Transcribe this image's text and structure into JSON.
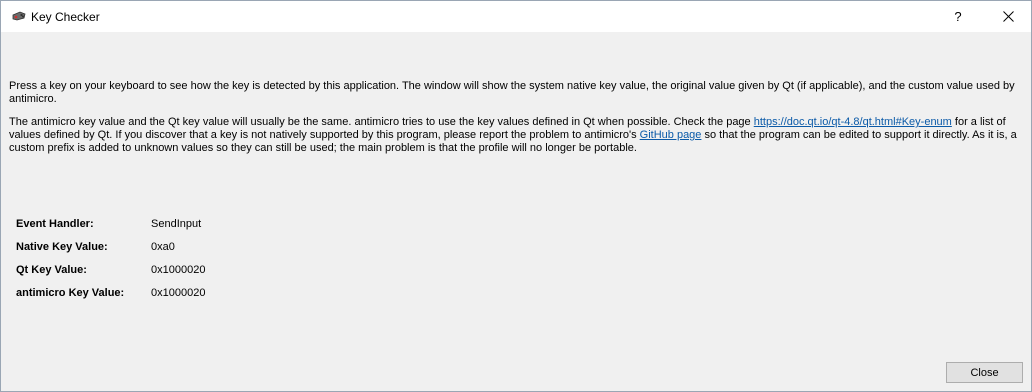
{
  "window": {
    "title": "Key Checker",
    "help_label": "?",
    "app_icon": "gamepad-icon",
    "close_icon": "close-icon"
  },
  "description": {
    "p1": "Press a key on your keyboard to see how the key is detected by this application. The window will show the system native key value, the original value given by Qt (if applicable), and the custom value used by antimicro.",
    "p2_part1": "The antimicro key value and the Qt key value will usually be the same. antimicro tries to use the key values defined in Qt when possible. Check the page ",
    "p2_link1": "https://doc.qt.io/qt-4.8/qt.html#Key-enum",
    "p2_part2": " for a list of values defined by Qt. If you discover that a key is not natively supported by this program, please report the problem to antimicro's ",
    "p2_link2": "GitHub page",
    "p2_part3": " so that the program can be edited to support it directly. As it is, a custom prefix is added to unknown values so they can still be used; the main problem is that the profile will no longer be portable."
  },
  "info": [
    {
      "label": "Event Handler:",
      "value": "SendInput"
    },
    {
      "label": "Native Key Value:",
      "value": "0xa0"
    },
    {
      "label": "Qt Key Value:",
      "value": "0x1000020"
    },
    {
      "label": "antimicro Key Value:",
      "value": "0x1000020"
    }
  ],
  "buttons": {
    "close_label": "Close"
  }
}
